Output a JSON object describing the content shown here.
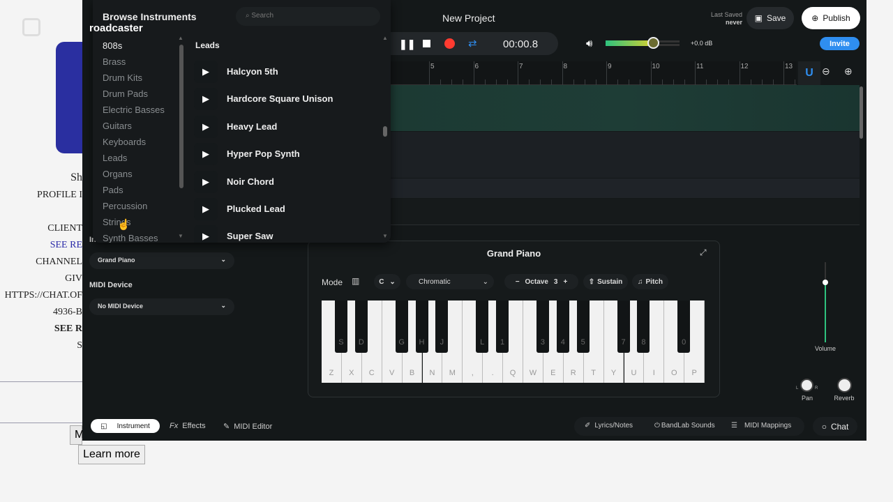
{
  "background_page": {
    "brand": "roadcaster",
    "lines": [
      "Sh",
      "PROFILE I",
      "CLIENT",
      "SEE RE",
      "CHANNEL",
      "GIV",
      "HTTPS://CHAT.OF",
      "4936-B",
      "SEE R",
      "S"
    ],
    "partial_button": "M",
    "learn_more": "Learn more"
  },
  "header": {
    "project_title": "New Project",
    "last_saved_label": "Last Saved",
    "last_saved_value": "never",
    "save": "Save",
    "publish": "Publish",
    "invite": "Invite",
    "time": "00:00.8",
    "volume_db": "+0.0 dB",
    "master_volume_level": 0.65
  },
  "ruler": [
    "5",
    "6",
    "7",
    "8",
    "9",
    "10",
    "11",
    "12",
    "13"
  ],
  "browser": {
    "title": "Browse Instruments",
    "search_placeholder": "Search",
    "categories": [
      "808s",
      "Brass",
      "Drum Kits",
      "Drum Pads",
      "Electric Basses",
      "Guitars",
      "Keyboards",
      "Leads",
      "Organs",
      "Pads",
      "Percussion",
      "Strings",
      "Synth Basses"
    ],
    "section_title": "Leads",
    "instruments": [
      "Halcyon 5th",
      "Hardcore Square Unison",
      "Heavy Lead",
      "Hyper Pop Synth",
      "Noir Chord",
      "Plucked Lead",
      "Super Saw"
    ]
  },
  "sidebar": {
    "instrument_label": "Instrument",
    "instrument_value": "Grand Piano",
    "midi_label": "MIDI Device",
    "midi_value": "No MIDI Device"
  },
  "piano": {
    "title": "Grand Piano",
    "mode_label": "Mode",
    "key": "C",
    "scale": "Chromatic",
    "octave_label": "Octave",
    "octave_value": "3",
    "sustain": "Sustain",
    "pitch": "Pitch",
    "white_keys": [
      "Z",
      "X",
      "C",
      "V",
      "B",
      "N",
      "M",
      ",",
      ".",
      "Q",
      "W",
      "E",
      "R",
      "T",
      "Y",
      "U",
      "I",
      "O",
      "P"
    ],
    "black_keys": [
      "S",
      "D",
      "G",
      "H",
      "J",
      "L",
      "1",
      "3",
      "4",
      "5",
      "7",
      "8",
      "0"
    ]
  },
  "mixer": {
    "volume": "Volume",
    "pan": "Pan",
    "reverb": "Reverb",
    "pan_l": "L",
    "pan_r": "R",
    "volume_level": 0.75
  },
  "bottom_tabs": [
    "Instrument",
    "Effects",
    "MIDI Editor"
  ],
  "bottom_right": [
    "Lyrics/Notes",
    "BandLab Sounds",
    "MIDI Mappings",
    "Chat"
  ],
  "colors": {
    "accent_blue": "#2f8ef0",
    "record_red": "#ff3b30",
    "track_green": "#1c3a33",
    "volume_green": "#2ec27e"
  }
}
